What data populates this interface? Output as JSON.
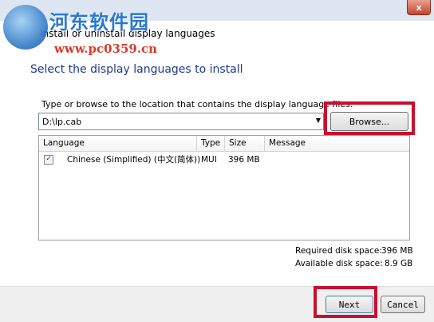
{
  "window": {
    "title": "Install or uninstall display languages",
    "close_label": "x"
  },
  "watermark": {
    "name": "河东软件园",
    "url": "www.pc0359.cn"
  },
  "page": {
    "heading": "Select the display languages to install",
    "path_label": "Type or browse to the location that contains the display language files:",
    "path_value": "D:\\lp.cab",
    "browse_label": "Browse..."
  },
  "table": {
    "columns": [
      "Language",
      "Type",
      "Size",
      "Message"
    ],
    "rows": [
      {
        "checked": true,
        "language": "Chinese (Simplified) (中文(简体))",
        "type": "MUI",
        "size": "396 MB",
        "message": ""
      }
    ]
  },
  "disk": {
    "required_label": "Required disk space:",
    "required_value": "396 MB",
    "available_label": "Available disk space:",
    "available_value": "8.9 GB"
  },
  "footer": {
    "next_label": "Next",
    "cancel_label": "Cancel"
  },
  "colors": {
    "highlight": "#c8102e",
    "heading": "#1c3a8c"
  }
}
